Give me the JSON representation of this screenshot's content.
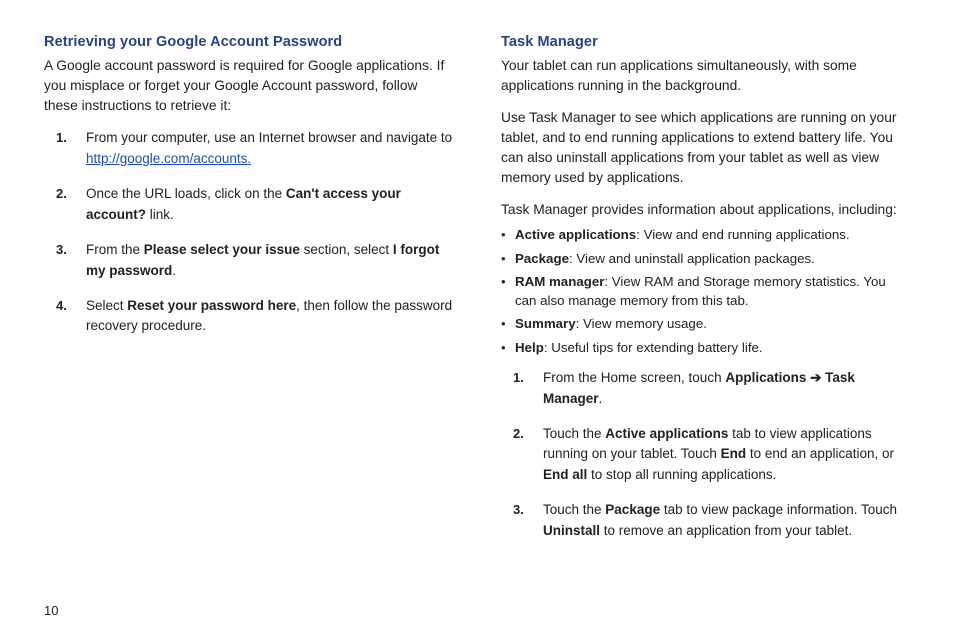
{
  "pageNumber": "10",
  "left": {
    "heading": "Retrieving your Google Account Password",
    "intro": "A Google account password is required for Google applications. If you misplace or forget your Google Account password, follow these instructions to retrieve it:",
    "step1_pre": "From your computer, use an Internet browser and navigate to ",
    "step1_link": "http://google.com/accounts.",
    "step2_pre": "Once the URL loads, click on the ",
    "step2_bold": "Can't access your account?",
    "step2_post": " link.",
    "step3_pre": "From the ",
    "step3_bold1": "Please select your issue",
    "step3_mid": " section, select ",
    "step3_bold2": "I forgot my password",
    "step3_post": ".",
    "step4_pre": "Select ",
    "step4_bold": "Reset your password here",
    "step4_post": ", then follow the password recovery procedure."
  },
  "right": {
    "heading": "Task Manager",
    "para1": "Your tablet can run applications simultaneously, with some applications running in the background.",
    "para2": "Use Task Manager to see which applications are running on your tablet, and to end running applications to extend battery life. You can also uninstall applications from your tablet as well as view memory used by applications.",
    "para3": "Task Manager provides information about applications, including:",
    "b1_label": "Active applications",
    "b1_text": ": View and end running applications.",
    "b2_label": "Package",
    "b2_text": ": View and uninstall application packages.",
    "b3_label": "RAM manager",
    "b3_text": ": View RAM and Storage memory statistics. You can also manage memory from this tab.",
    "b4_label": "Summary",
    "b4_text": ": View memory usage.",
    "b5_label": "Help",
    "b5_text": ": Useful tips for extending battery life.",
    "s1_pre": "From the Home screen, touch ",
    "s1_apps": "Applications",
    "s1_arrow": " ➔ ",
    "s1_tm": "Task Manager",
    "s1_post": ".",
    "s2_pre": "Touch the ",
    "s2_aa": "Active applications",
    "s2_mid1": " tab to view applications running on your tablet. Touch ",
    "s2_end": "End",
    "s2_mid2": " to end an application, or ",
    "s2_endall": "End all",
    "s2_post": " to stop all running applications.",
    "s3_pre": "Touch the ",
    "s3_pkg": "Package",
    "s3_mid": " tab to view package information. Touch ",
    "s3_uninst": "Uninstall",
    "s3_post": " to remove an application from your tablet."
  }
}
